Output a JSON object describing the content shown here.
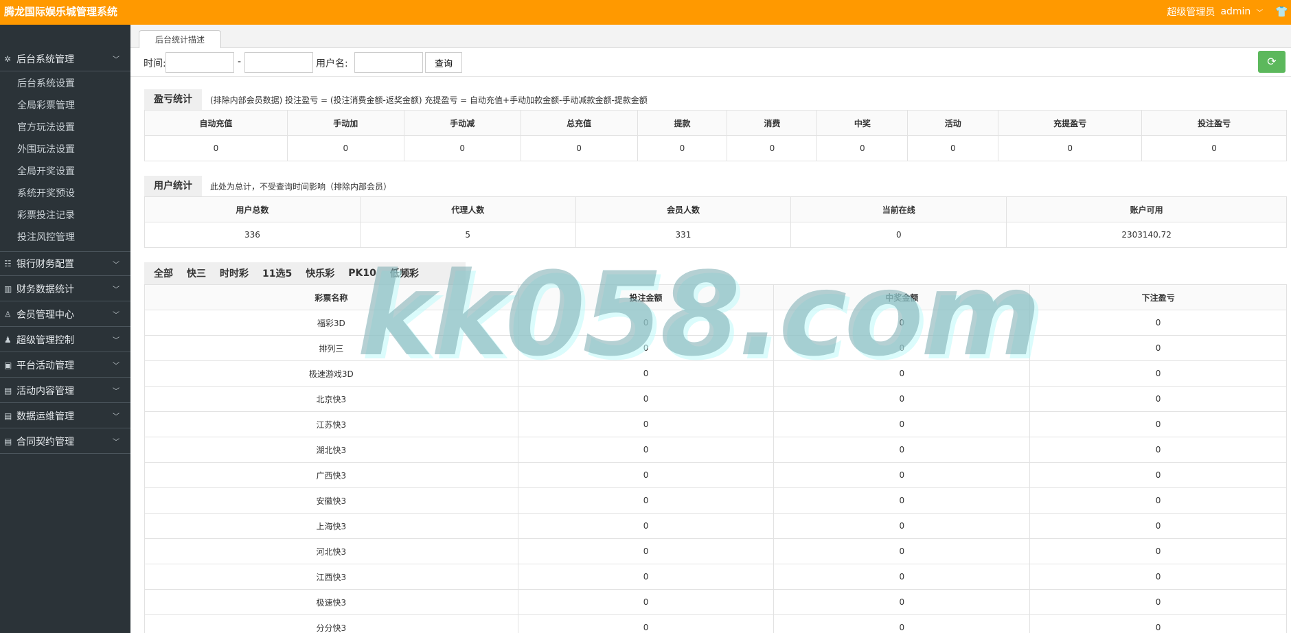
{
  "header": {
    "brand": "腾龙国际娱乐城管理系统",
    "role": "超级管理员",
    "user": "admin"
  },
  "sidebar": {
    "groups": [
      {
        "label": "后台系统管理",
        "icon": "gear-icon",
        "glyph": "✲"
      },
      {
        "label": "银行财务配置",
        "icon": "list-icon",
        "glyph": "☷"
      },
      {
        "label": "财务数据统计",
        "icon": "chart-icon",
        "glyph": "▥"
      },
      {
        "label": "会员管理中心",
        "icon": "user-icon",
        "glyph": "♙"
      },
      {
        "label": "超级管理控制",
        "icon": "admin-icon",
        "glyph": "♟"
      },
      {
        "label": "平台活动管理",
        "icon": "gift-icon",
        "glyph": "▣"
      },
      {
        "label": "活动内容管理",
        "icon": "document-icon",
        "glyph": "▤"
      },
      {
        "label": "数据运维管理",
        "icon": "document-icon",
        "glyph": "▤"
      },
      {
        "label": "合同契约管理",
        "icon": "document-icon",
        "glyph": "▤"
      }
    ],
    "sub_items": [
      "后台系统设置",
      "全局彩票管理",
      "官方玩法设置",
      "外围玩法设置",
      "全局开奖设置",
      "系统开奖预设",
      "彩票投注记录",
      "投注风控管理"
    ]
  },
  "tab": {
    "label": "后台统计描述"
  },
  "filters": {
    "time_label": "时间:",
    "dash": "-",
    "username_label": "用户名:",
    "query_button": "查询"
  },
  "profit": {
    "title": "盈亏统计",
    "note": "(排除内部会员数据)  投注盈亏 = (投注消费金额-返奖金额)    充提盈亏 = 自动充值+手动加款金额-手动减款金额-提款金额",
    "headers": [
      "自动充值",
      "手动加",
      "手动减",
      "总充值",
      "提款",
      "消费",
      "中奖",
      "活动",
      "充提盈亏",
      "投注盈亏"
    ],
    "values": [
      "0",
      "0",
      "0",
      "0",
      "0",
      "0",
      "0",
      "0",
      "0",
      "0"
    ]
  },
  "users": {
    "title": "用户统计",
    "note": "此处为总计，不受查询时间影响（排除内部会员）",
    "headers": [
      "用户总数",
      "代理人数",
      "会员人数",
      "当前在线",
      "账户可用"
    ],
    "values": [
      "336",
      "5",
      "331",
      "0",
      "2303140.72"
    ]
  },
  "lottery_tabs": [
    "全部",
    "快三",
    "时时彩",
    "11选5",
    "快乐彩",
    "PK10",
    "低频彩"
  ],
  "lottery": {
    "headers": [
      "彩票名称",
      "投注金额",
      "中奖金额",
      "下注盈亏"
    ],
    "rows": [
      [
        "福彩3D",
        "0",
        "0",
        "0"
      ],
      [
        "排列三",
        "0",
        "0",
        "0"
      ],
      [
        "极速游戏3D",
        "0",
        "0",
        "0"
      ],
      [
        "北京快3",
        "0",
        "0",
        "0"
      ],
      [
        "江苏快3",
        "0",
        "0",
        "0"
      ],
      [
        "湖北快3",
        "0",
        "0",
        "0"
      ],
      [
        "广西快3",
        "0",
        "0",
        "0"
      ],
      [
        "安徽快3",
        "0",
        "0",
        "0"
      ],
      [
        "上海快3",
        "0",
        "0",
        "0"
      ],
      [
        "河北快3",
        "0",
        "0",
        "0"
      ],
      [
        "江西快3",
        "0",
        "0",
        "0"
      ],
      [
        "极速快3",
        "0",
        "0",
        "0"
      ],
      [
        "分分快3",
        "0",
        "0",
        "0"
      ]
    ]
  },
  "watermark": "kk058.com"
}
